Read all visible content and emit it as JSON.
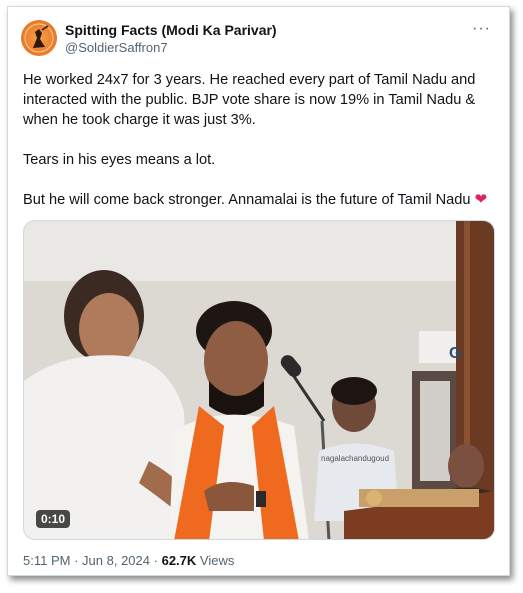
{
  "author": {
    "display_name": "Spitting Facts (Modi Ka Parivar)",
    "handle": "@SoldierSaffron7",
    "avatar_icon": "avatar-saffron-icon"
  },
  "menu": {
    "more_label": "···"
  },
  "tweet": {
    "paragraphs": [
      "He worked 24x7 for 3 years. He reached every part of Tamil Nadu and interacted with the public. BJP vote share is now 19% in Tamil Nadu & when he took charge it was just 3%.",
      "Tears in his eyes means a lot.",
      "But he will come back stronger. Annamalai is the future of Tamil Nadu"
    ],
    "emoji": "❤"
  },
  "media": {
    "watermark": "nagalachandugoud",
    "duration": "0:10",
    "sign_letter": "G"
  },
  "meta": {
    "time": "5:11 PM",
    "separator": "·",
    "date": "Jun 8, 2024",
    "views_count": "62.7K",
    "views_label": "Views"
  },
  "colors": {
    "text": "#0f1419",
    "secondary": "#536471",
    "border": "#cfd9de",
    "heart": "#e0245e",
    "saffron": "#e9782a"
  }
}
